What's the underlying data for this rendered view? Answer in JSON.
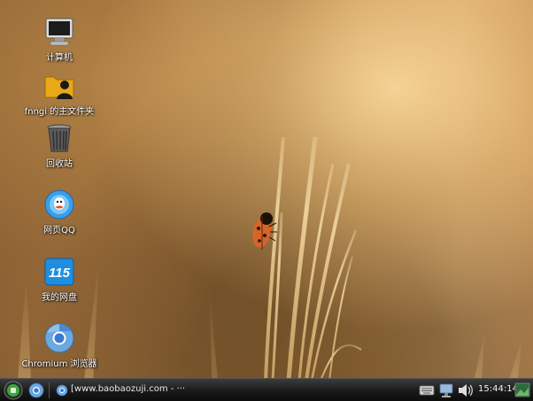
{
  "desktop": {
    "icons": [
      {
        "label": "计算机",
        "icon": "computer-icon"
      },
      {
        "label": "fnngi 的主文件夹",
        "icon": "home-folder-icon"
      },
      {
        "label": "回收站",
        "icon": "trash-icon"
      },
      {
        "label": "网页QQ",
        "icon": "qq-icon"
      },
      {
        "label": "我的网盘",
        "icon": "netdisk-115-icon"
      },
      {
        "label": "Chromium 浏览器",
        "icon": "chromium-icon"
      }
    ],
    "netdisk_logo_text": "115"
  },
  "taskbar": {
    "start_icon": "start-menu-icon",
    "quick_launch_icon": "chromium-icon",
    "task_label": "[www.baobaozuji.com - ···",
    "tray_icons": [
      "keyboard-icon",
      "network-icon",
      "volume-icon",
      "show-desktop-icon"
    ],
    "clock": "15:44:14"
  },
  "colors": {
    "taskbar": "#1a1a1a",
    "start_button": "#3aa83a",
    "label_text": "#ffffff"
  }
}
